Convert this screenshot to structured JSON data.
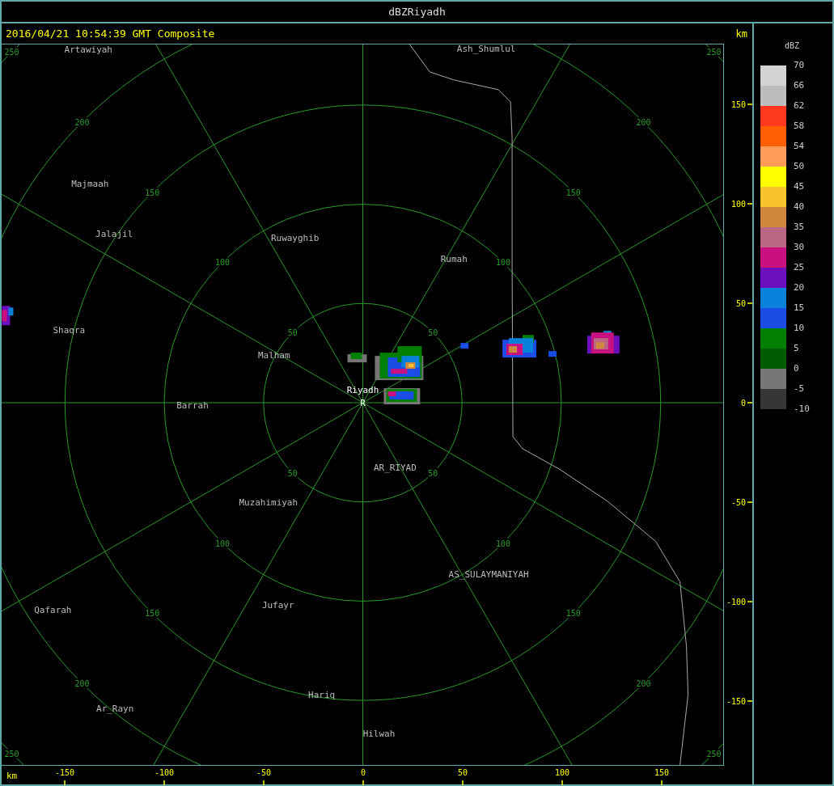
{
  "window": {
    "title": "dBZRiyadh"
  },
  "header": {
    "timestamp": "2016/04/21 10:54:39 GMT Composite",
    "y_unit": "km"
  },
  "map": {
    "places": [
      {
        "name": "Artawiyah",
        "kind": "place"
      },
      {
        "name": "Ash_Shumlul",
        "kind": "place"
      },
      {
        "name": "Majmaah",
        "kind": "place"
      },
      {
        "name": "Jalajil",
        "kind": "place"
      },
      {
        "name": "Ruwayghib",
        "kind": "place"
      },
      {
        "name": "Rumah",
        "kind": "place"
      },
      {
        "name": "Shaqra",
        "kind": "place"
      },
      {
        "name": "Malham",
        "kind": "place"
      },
      {
        "name": "Riyadh",
        "kind": "site"
      },
      {
        "name": "R",
        "kind": "marker"
      },
      {
        "name": "Barrah",
        "kind": "place"
      },
      {
        "name": "AR_RIYAD",
        "kind": "place"
      },
      {
        "name": "Muzahimiyah",
        "kind": "place"
      },
      {
        "name": "AS_SULAYMANIYAH",
        "kind": "place"
      },
      {
        "name": "Qafarah",
        "kind": "place"
      },
      {
        "name": "Jufayr",
        "kind": "place"
      },
      {
        "name": "Hariq",
        "kind": "place"
      },
      {
        "name": "Ar_Rayn",
        "kind": "place"
      },
      {
        "name": "Hilwah",
        "kind": "place"
      }
    ],
    "range_rings": [
      {
        "labels": [
          "50",
          "50",
          "50",
          "50"
        ]
      },
      {
        "labels": [
          "100",
          "100",
          "100",
          "100"
        ]
      },
      {
        "labels": [
          "150",
          "150",
          "150",
          "150"
        ]
      },
      {
        "labels": [
          "200",
          "200",
          "200",
          "200"
        ]
      },
      {
        "labels": [
          "250",
          "250",
          "250",
          "250"
        ]
      }
    ]
  },
  "x_axis": {
    "unit": "km",
    "ticks": [
      "-150",
      "-100",
      "-50",
      "0",
      "50",
      "100",
      "150"
    ]
  },
  "y_axis": {
    "ticks": [
      "150",
      "100",
      "50",
      "0",
      "-50",
      "-100",
      "-150"
    ]
  },
  "legend": {
    "title": "dBZ",
    "bins": [
      {
        "color": "#d3d3d3"
      },
      {
        "color": "#bdbdbd"
      },
      {
        "color": "#ff3820"
      },
      {
        "color": "#ff5f00"
      },
      {
        "color": "#ff9c5a"
      },
      {
        "color": "#ffff00"
      },
      {
        "color": "#f9c22f"
      },
      {
        "color": "#cf893c"
      },
      {
        "color": "#bc6686"
      },
      {
        "color": "#c8117f"
      },
      {
        "color": "#6c0fbf"
      },
      {
        "color": "#0a82dc"
      },
      {
        "color": "#1b4de6"
      },
      {
        "color": "#007f00"
      },
      {
        "color": "#005c00"
      },
      {
        "color": "#767676"
      },
      {
        "color": "#363636"
      }
    ],
    "labels": [
      "70",
      "66",
      "62",
      "58",
      "54",
      "50",
      "45",
      "40",
      "35",
      "30",
      "25",
      "20",
      "15",
      "10",
      "5",
      "0",
      "-5",
      "-10"
    ]
  }
}
